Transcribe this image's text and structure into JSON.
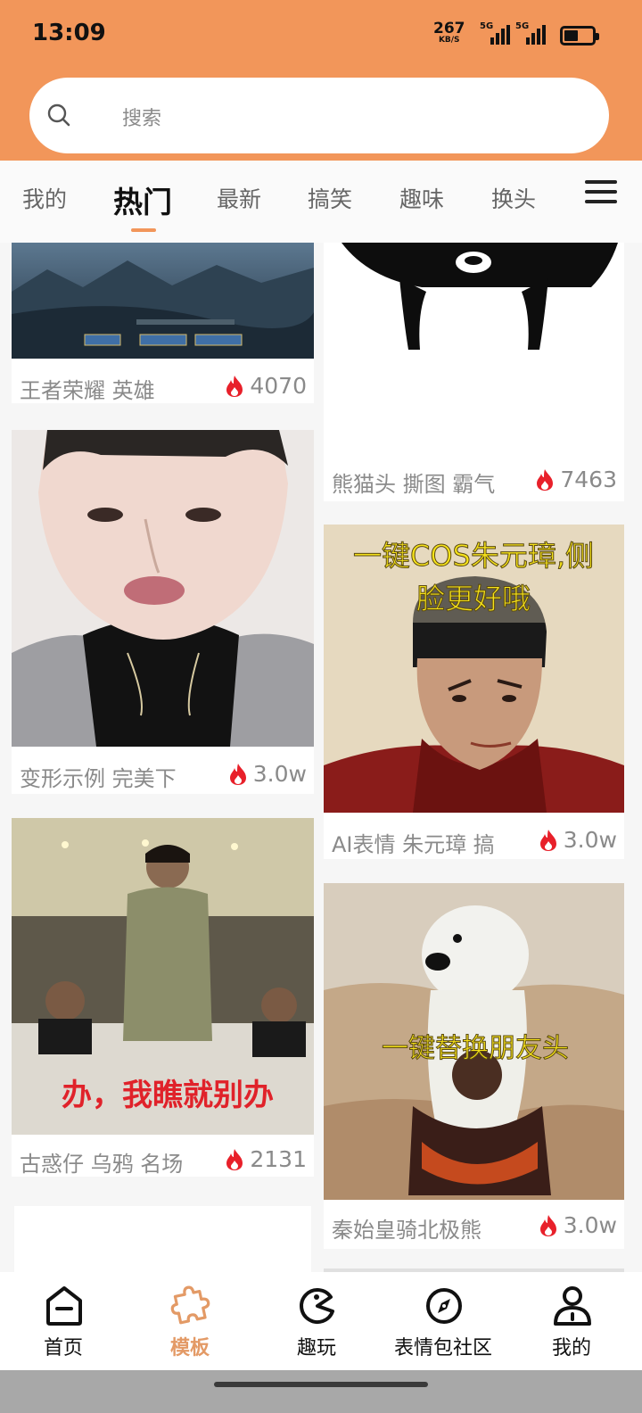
{
  "status_bar": {
    "time": "13:09",
    "net_speed_value": "267",
    "net_speed_unit": "KB/S",
    "signal_1_label": "5G",
    "signal_2_label": "5G"
  },
  "search": {
    "placeholder": "搜索"
  },
  "tabs": [
    {
      "label": "我的"
    },
    {
      "label": "热门",
      "active": true
    },
    {
      "label": "最新"
    },
    {
      "label": "搞笑"
    },
    {
      "label": "趣味"
    },
    {
      "label": "换头"
    }
  ],
  "cards": [
    {
      "title": "王者荣耀 英雄",
      "heat": "4070",
      "caption": ""
    },
    {
      "title": "熊猫头 撕图 霸气",
      "heat": "7463",
      "caption": ""
    },
    {
      "title": "变形示例 完美下",
      "heat": "3.0w",
      "caption": ""
    },
    {
      "title": "AI表情 朱元璋 搞",
      "heat": "3.0w",
      "caption": "一键COS朱元璋,侧脸更好哦"
    },
    {
      "title": "古惑仔 乌鸦 名场",
      "heat": "2131",
      "caption": "办，我瞧就别办"
    },
    {
      "title": "秦始皇骑北极熊",
      "heat": "3.0w",
      "caption": "一键替换朋友头"
    }
  ],
  "bottom_nav": [
    {
      "label": "首页",
      "icon": "home-icon"
    },
    {
      "label": "模板",
      "icon": "puzzle-icon",
      "active": true
    },
    {
      "label": "趣玩",
      "icon": "pacman-icon"
    },
    {
      "label": "表情包社区",
      "icon": "compass-icon"
    },
    {
      "label": "我的",
      "icon": "user-icon"
    }
  ],
  "colors": {
    "accent": "#f2965a",
    "active_nav": "#e39a66",
    "flame": "#e8202a"
  }
}
